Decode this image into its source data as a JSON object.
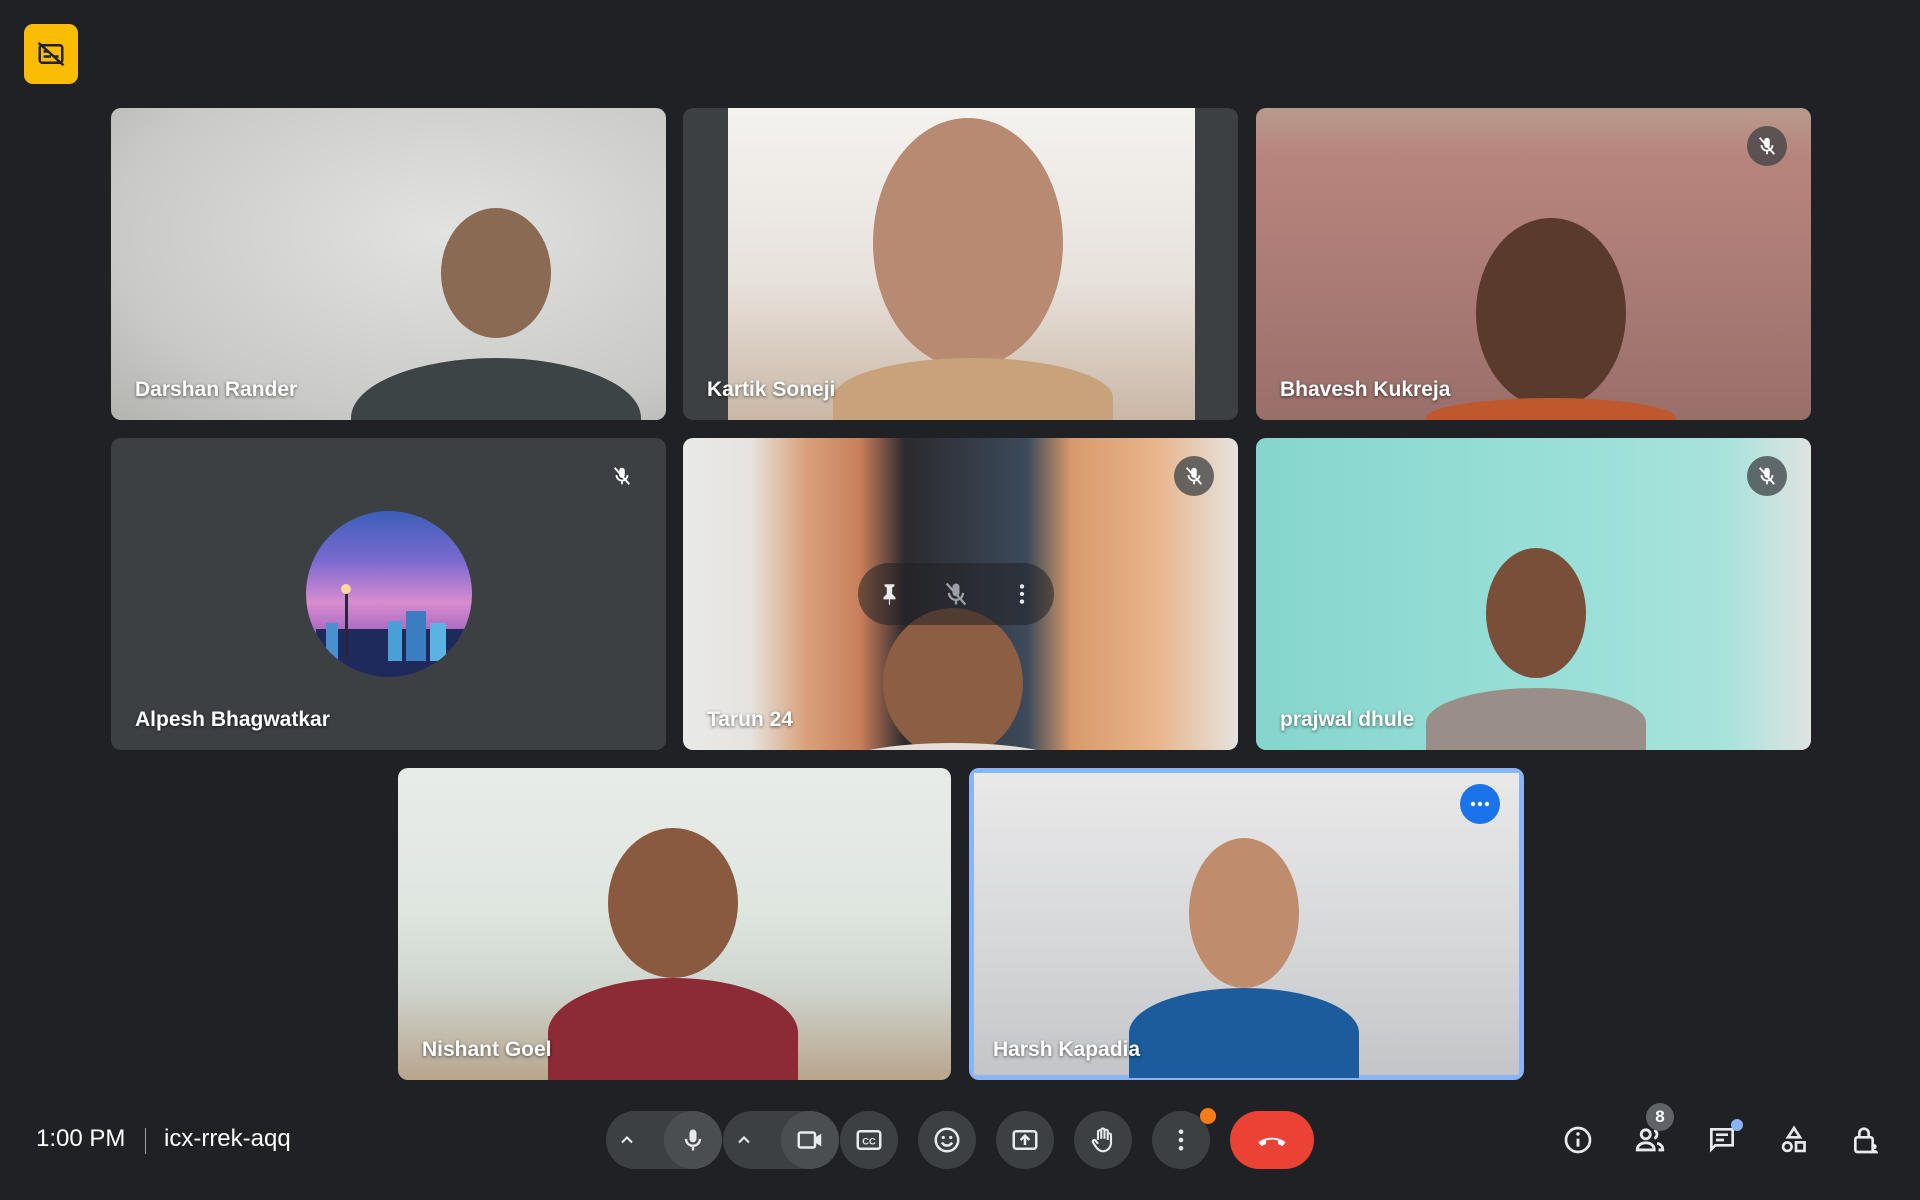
{
  "top_badge": {
    "icon": "captions-off-icon",
    "color": "#fbbc04"
  },
  "participants": [
    {
      "name": "Darshan Rander",
      "muted": false
    },
    {
      "name": "Kartik Soneji",
      "muted": false
    },
    {
      "name": "Bhavesh Kukreja",
      "muted": true
    },
    {
      "name": "Alpesh Bhagwatkar",
      "muted": true,
      "camera_off": true
    },
    {
      "name": "Tarun 24",
      "muted": true
    },
    {
      "name": "prajwal dhule",
      "muted": true
    },
    {
      "name": "Nishant Goel",
      "muted": false
    },
    {
      "name": "Harsh Kapadia",
      "muted": false,
      "active_speaker": true
    }
  ],
  "bottom_bar": {
    "time": "1:00 PM",
    "meeting_code": "icx-rrek-aqq",
    "people_count": "8",
    "controls": [
      "mic-options",
      "microphone",
      "camera-options",
      "camera",
      "captions",
      "emoji-reactions",
      "present-screen",
      "raise-hand",
      "more-options",
      "leave-call"
    ],
    "right_icons": [
      "meeting-details",
      "people",
      "chat",
      "activities",
      "host-controls"
    ]
  },
  "colors": {
    "background": "#202124",
    "tile": "#3c4043",
    "active_outline": "#8ab4f8",
    "leave": "#ea4335"
  }
}
